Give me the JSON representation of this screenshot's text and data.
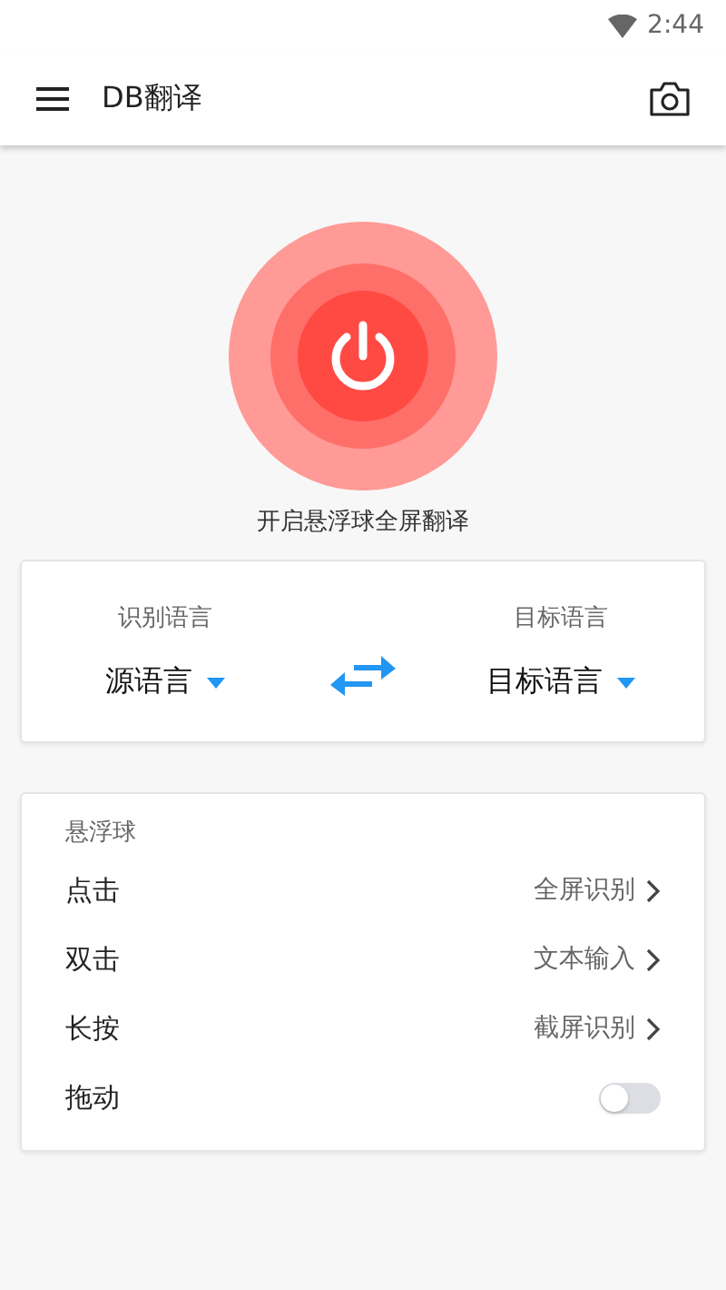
{
  "status_bar": {
    "time": "2:44"
  },
  "app_bar": {
    "title": "DB翻译"
  },
  "power": {
    "on": false,
    "caption": "开启悬浮球全屏翻译"
  },
  "languages": {
    "source": {
      "label": "识别语言",
      "value": "源语言"
    },
    "target": {
      "label": "目标语言",
      "value": "目标语言"
    }
  },
  "float_ball": {
    "title": "悬浮球",
    "rows": [
      {
        "kind": "link",
        "label": "点击",
        "value": "全屏识别"
      },
      {
        "kind": "link",
        "label": "双击",
        "value": "文本输入"
      },
      {
        "kind": "link",
        "label": "长按",
        "value": "截屏识别"
      },
      {
        "kind": "toggle",
        "label": "拖动",
        "on": false
      }
    ]
  }
}
